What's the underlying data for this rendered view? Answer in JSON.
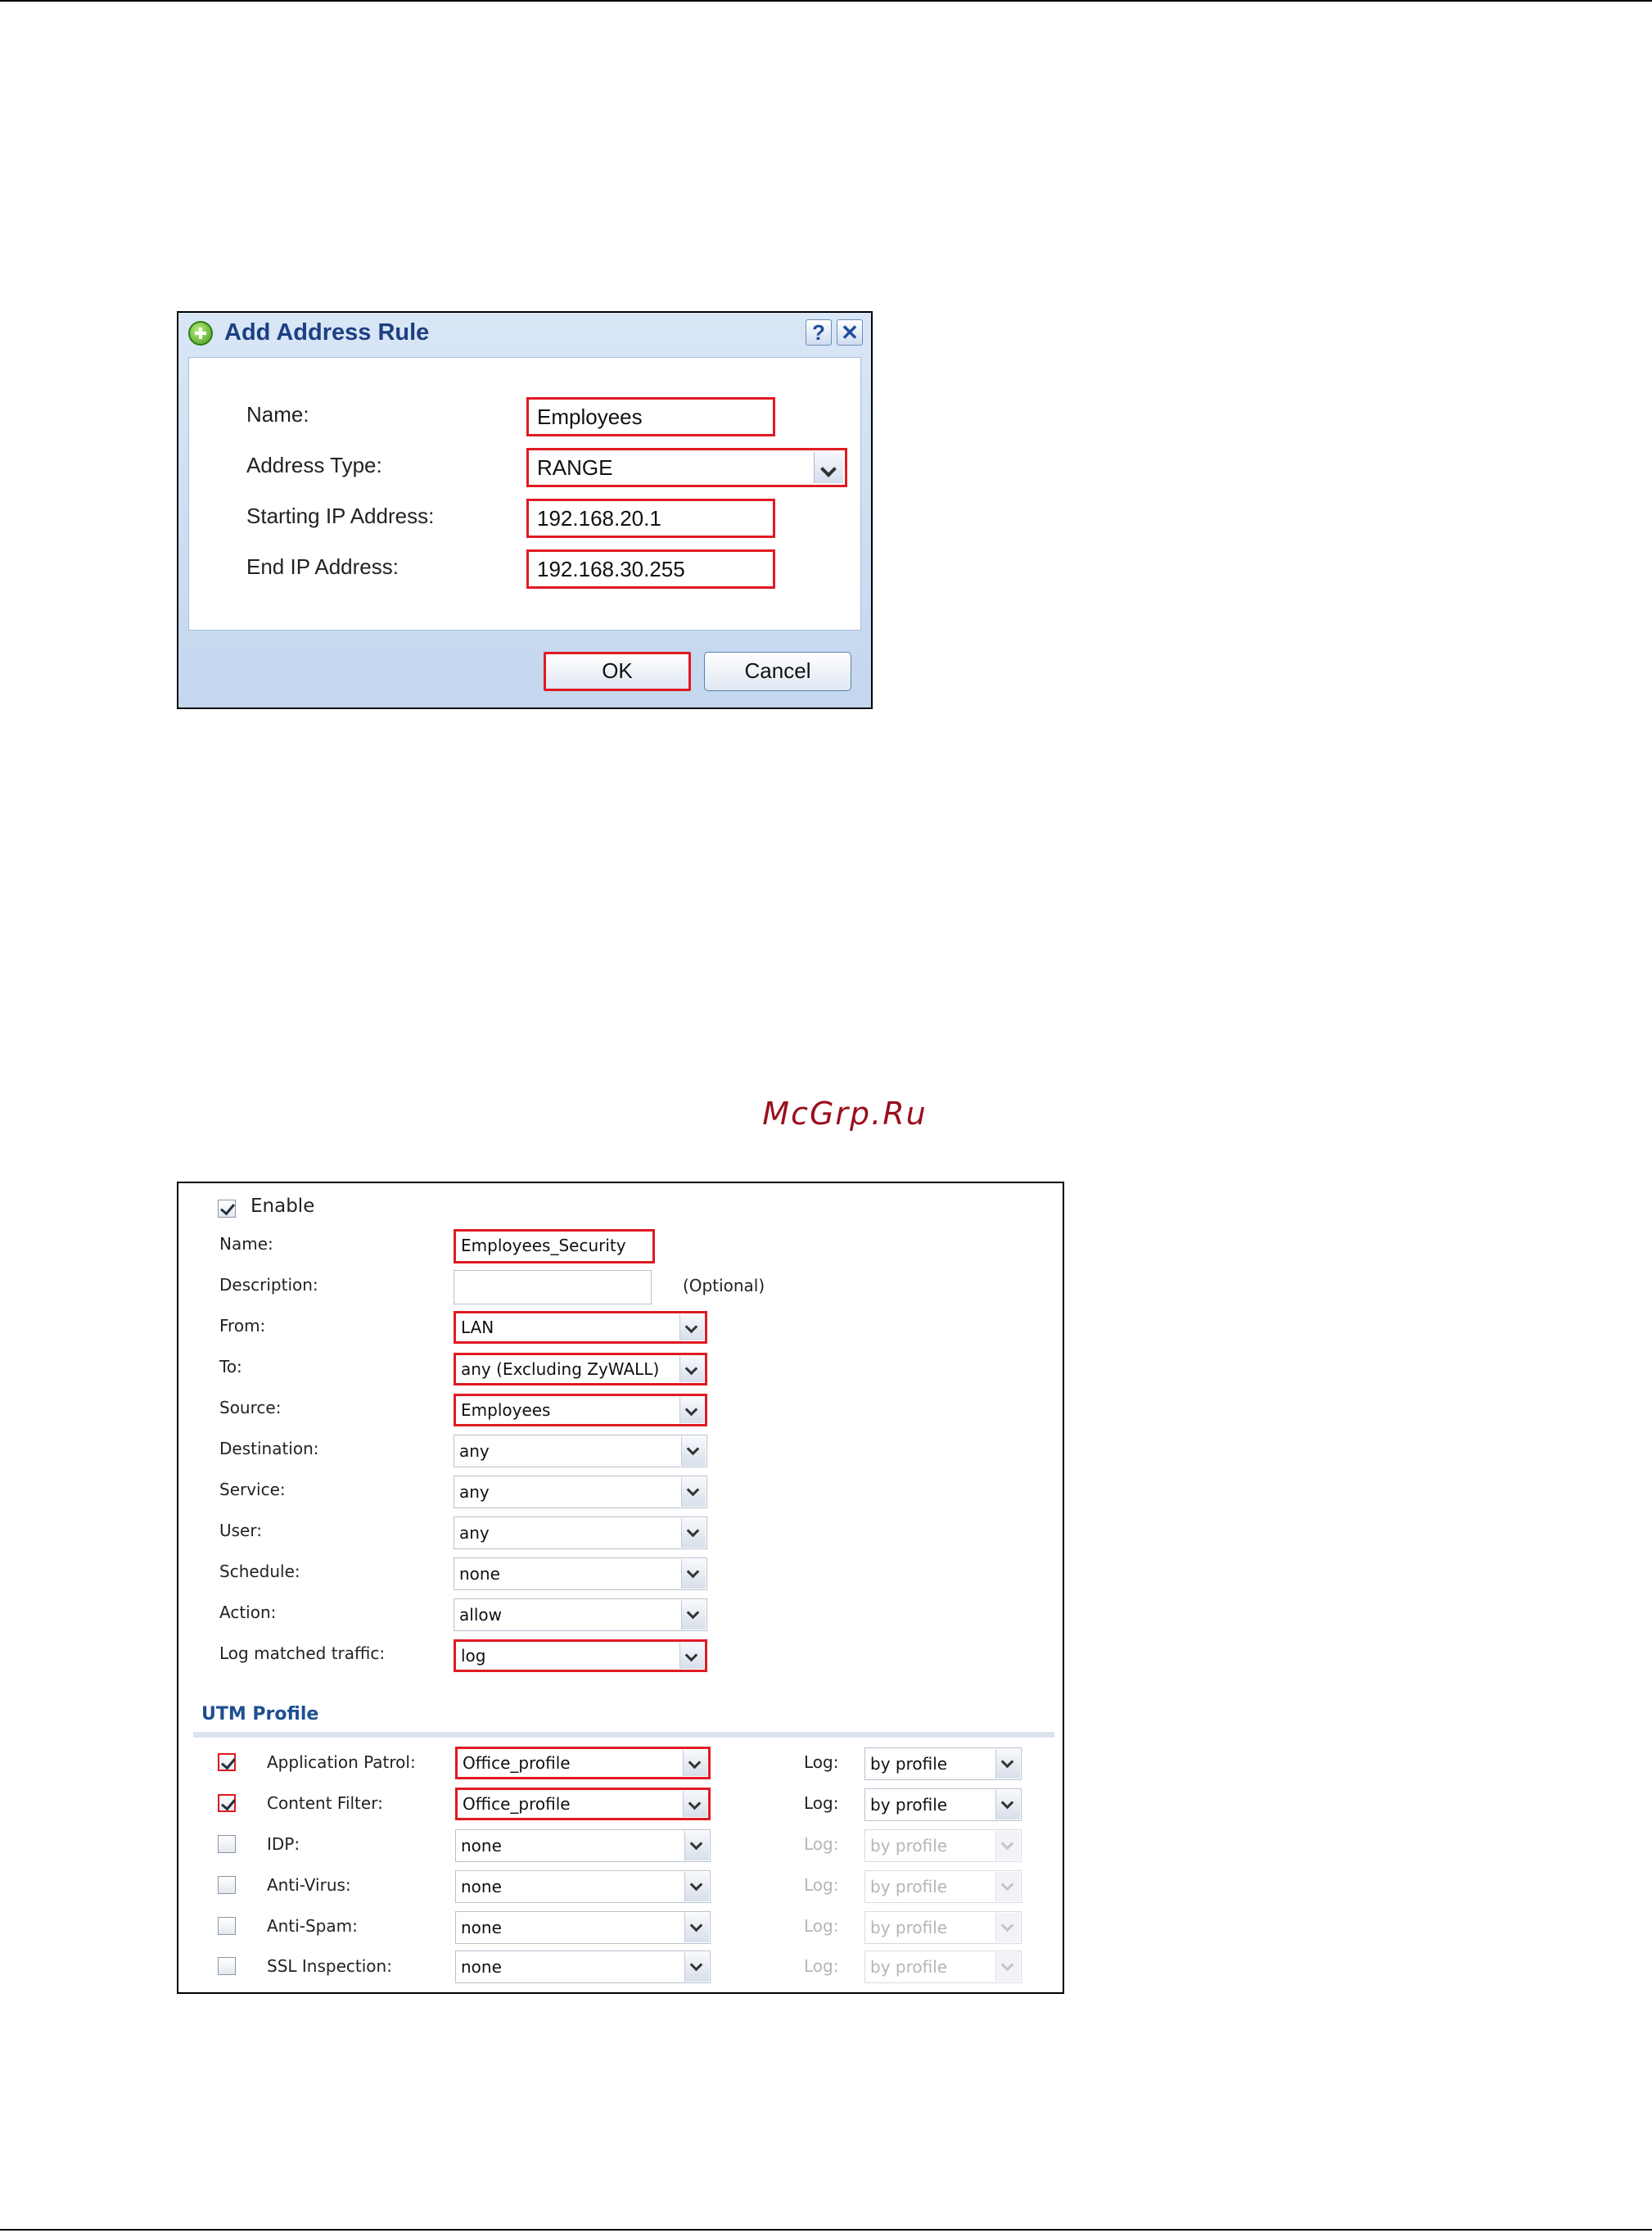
{
  "watermark": "McGrp.Ru",
  "address_dialog": {
    "title": "Add Address Rule",
    "help_icon": "?",
    "close_icon": "✕",
    "fields": [
      {
        "label": "Name:",
        "value": "Employees"
      },
      {
        "label": "Address Type:",
        "value": "RANGE"
      },
      {
        "label": "Starting IP Address:",
        "value": "192.168.20.1"
      },
      {
        "label": "End IP Address:",
        "value": "192.168.30.255"
      }
    ],
    "ok_label": "OK",
    "cancel_label": "Cancel"
  },
  "policy_dialog": {
    "enable_label": "Enable",
    "enable_checked": true,
    "name": {
      "label": "Name:",
      "value": "Employees_Security"
    },
    "description": {
      "label": "Description:",
      "value": "",
      "hint": "(Optional)"
    },
    "fields": [
      {
        "label": "From:",
        "value": "LAN"
      },
      {
        "label": "To:",
        "value": "any (Excluding ZyWALL)"
      },
      {
        "label": "Source:",
        "value": "Employees"
      },
      {
        "label": "Destination:",
        "value": "any"
      },
      {
        "label": "Service:",
        "value": "any"
      },
      {
        "label": "User:",
        "value": "any"
      },
      {
        "label": "Schedule:",
        "value": "none"
      },
      {
        "label": "Action:",
        "value": "allow"
      },
      {
        "label": "Log matched traffic:",
        "value": "log"
      }
    ],
    "utm_title": "UTM Profile",
    "log_label": "Log:",
    "utm_rows": [
      {
        "label": "Application Patrol:",
        "checked": true,
        "profile": "Office_profile",
        "log": "by profile"
      },
      {
        "label": "Content Filter:",
        "checked": true,
        "profile": "Office_profile",
        "log": "by profile"
      },
      {
        "label": "IDP:",
        "checked": false,
        "profile": "none",
        "log": "by profile"
      },
      {
        "label": "Anti-Virus:",
        "checked": false,
        "profile": "none",
        "log": "by profile"
      },
      {
        "label": "Anti-Spam:",
        "checked": false,
        "profile": "none",
        "log": "by profile"
      },
      {
        "label": "SSL Inspection:",
        "checked": false,
        "profile": "none",
        "log": "by profile"
      }
    ]
  }
}
